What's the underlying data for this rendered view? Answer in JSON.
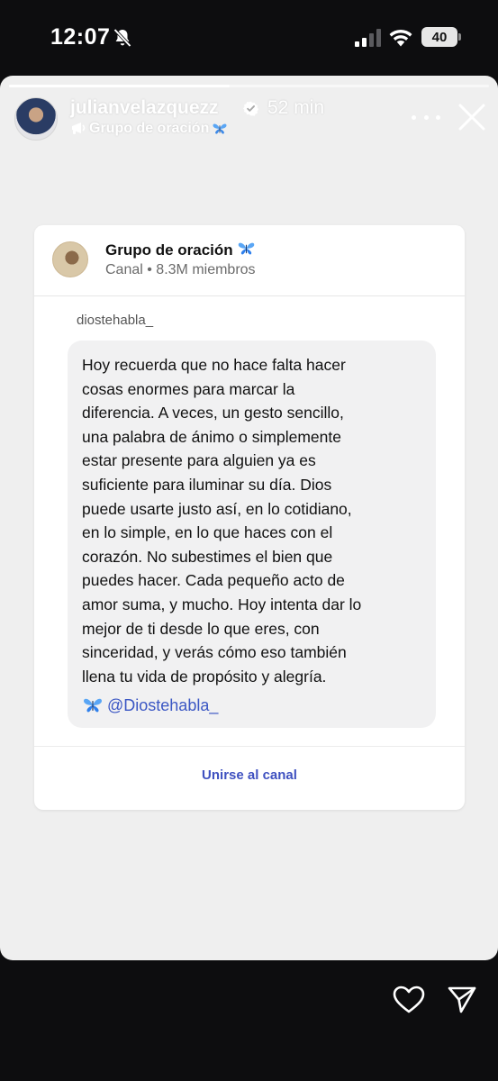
{
  "status_bar": {
    "time": "12:07",
    "battery": "40",
    "icons": [
      "bell-slash-icon",
      "signal-icon",
      "wifi-icon",
      "battery-icon"
    ]
  },
  "story": {
    "progress": 0.46,
    "username": "julianvelazquezz",
    "time_ago": "52 min",
    "subline": "Grupo de oración"
  },
  "card": {
    "channel_name": "Grupo de oración",
    "channel_meta": "Canal • 8.3M miembros",
    "author": "diostehabla_",
    "message": "Hoy recuerda que no hace falta hacer\ncosas enormes para marcar la\ndiferencia. A veces, un gesto sencillo,\nuna palabra de ánimo o simplemente\nestar presente para alguien ya es\nsuficiente para iluminar su día. Dios\npuede usarte justo así, en lo cotidiano,\nen lo simple, en lo que haces con el\ncorazón. No subestimes el bien que\npuedes hacer. Cada pequeño acto de\namor suma, y mucho. Hoy intenta dar lo\nmejor de ti desde lo que eres, con\nsinceridad, y verás cómo eso también\nllena tu vida de propósito y alegría.",
    "mention": "@Diostehabla_",
    "join_label": "Unirse al canal"
  },
  "colors": {
    "accent_blue": "#3f51c0",
    "butterfly_blue": "#2f80ed",
    "story_bg": "#efefef"
  }
}
